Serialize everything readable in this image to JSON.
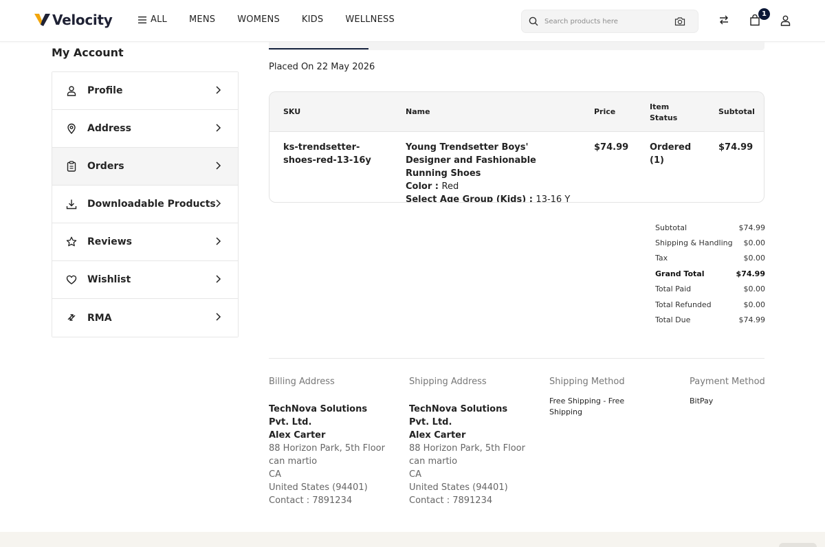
{
  "header": {
    "logo_text": "Velocity",
    "nav": {
      "all": "ALL",
      "mens": "MENS",
      "womens": "WOMENS",
      "kids": "KIDS",
      "wellness": "WELLNESS"
    },
    "search_placeholder": "Search products here",
    "cart_count": "1"
  },
  "sidebar": {
    "title": "My Account",
    "items": [
      {
        "label": "Profile",
        "icon": "user-icon"
      },
      {
        "label": "Address",
        "icon": "location-pin-icon"
      },
      {
        "label": "Orders",
        "icon": "clipboard-icon",
        "active": true
      },
      {
        "label": "Downloadable Products",
        "icon": "download-icon"
      },
      {
        "label": "Reviews",
        "icon": "star-icon"
      },
      {
        "label": "Wishlist",
        "icon": "heart-icon"
      },
      {
        "label": "RMA",
        "icon": "return-arrows-icon"
      }
    ]
  },
  "order": {
    "placed_on": "Placed On 22 May 2026",
    "columns": {
      "sku": "SKU",
      "name": "Name",
      "price": "Price",
      "item_status": "Item Status",
      "subtotal": "Subtotal"
    },
    "item": {
      "sku": "ks-trendsetter-shoes-red-13-16y",
      "name": "Young Trendsetter Boys' Designer and Fashionable Running Shoes",
      "color_label": "Color :",
      "color_value": "Red",
      "age_label": "Select Age Group (Kids) :",
      "age_value": "13-16 Y",
      "price": "$74.99",
      "status": "Ordered (1)",
      "subtotal": "$74.99"
    }
  },
  "totals": [
    {
      "label": "Subtotal",
      "value": "$74.99"
    },
    {
      "label": "Shipping & Handling",
      "value": "$0.00"
    },
    {
      "label": "Tax",
      "value": "$0.00"
    },
    {
      "label": "Grand Total",
      "value": "$74.99",
      "bold": true
    },
    {
      "label": "Total Paid",
      "value": "$0.00"
    },
    {
      "label": "Total Refunded",
      "value": "$0.00"
    },
    {
      "label": "Total Due",
      "value": "$74.99"
    }
  ],
  "billing": {
    "heading": "Billing Address",
    "company": "TechNova Solutions Pvt. Ltd.",
    "name": "Alex Carter",
    "street": "88 Horizon Park, 5th Floor",
    "city": "can martio",
    "state": "CA",
    "country": "United States (94401)",
    "contact": "Contact : 7891234"
  },
  "shipping": {
    "heading": "Shipping Address",
    "company": "TechNova Solutions Pvt. Ltd.",
    "name": "Alex Carter",
    "street": "88 Horizon Park, 5th Floor",
    "city": "can martio",
    "state": "CA",
    "country": "United States (94401)",
    "contact": "Contact : 7891234"
  },
  "shipping_method": {
    "heading": "Shipping Method",
    "value": "Free Shipping - Free Shipping"
  },
  "payment_method": {
    "heading": "Payment Method",
    "value": "BitPay"
  }
}
